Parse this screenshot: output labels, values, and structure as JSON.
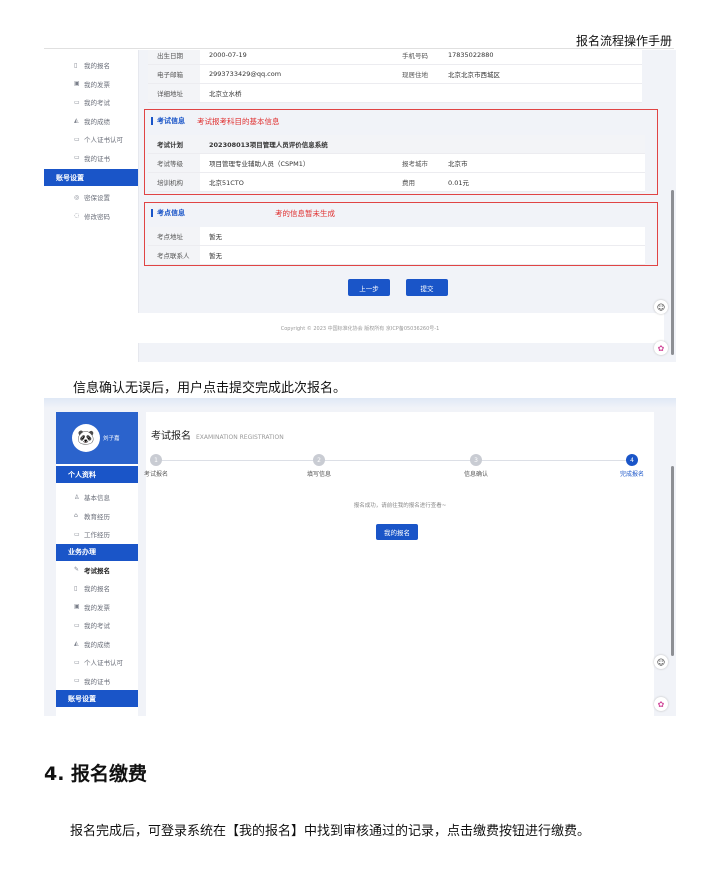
{
  "header": {
    "title": "报名流程操作手册"
  },
  "shot1": {
    "sidebar": {
      "items_top": [
        {
          "icon": "file-icon",
          "glyph": "▯",
          "label": "我的报名"
        },
        {
          "icon": "invoice-icon",
          "glyph": "▣",
          "label": "我的发票"
        },
        {
          "icon": "exam-icon",
          "glyph": "▭",
          "label": "我的考试"
        },
        {
          "icon": "score-icon",
          "glyph": "◭",
          "label": "我的成绩"
        },
        {
          "icon": "cert-icon",
          "glyph": "▭",
          "label": "个人证书认可"
        },
        {
          "icon": "certificate-icon",
          "glyph": "▭",
          "label": "我的证书"
        }
      ],
      "account_head": "账号设置",
      "items_account": [
        {
          "icon": "shield-icon",
          "glyph": "◎",
          "label": "密保设置"
        },
        {
          "icon": "lock-icon",
          "glyph": "◌",
          "label": "修改密码"
        }
      ]
    },
    "personal_rows": [
      {
        "l1": "出生日期",
        "v1": "2000-07-19",
        "l2": "手机号码",
        "v2": "17835022880"
      },
      {
        "l1": "电子邮箱",
        "v1": "2993733429@qq.com",
        "l2": "现居住地",
        "v2": "北京北京市西城区"
      },
      {
        "l1": "详细地址",
        "v1": "北京立水桥",
        "l2": "",
        "v2": ""
      }
    ],
    "exam_section": {
      "title": "考试信息",
      "note": "考试报考科目的基本信息",
      "plan_label": "考试计划",
      "plan_value": "202308013项目管理人员评价信息系统",
      "rows": [
        {
          "l1": "考试等级",
          "v1": "项目管理专业辅助人员（CSPM1）",
          "l2": "报考城市",
          "v2": "北京市"
        },
        {
          "l1": "培训机构",
          "v1": "北京51CTO",
          "l2": "费用",
          "v2": "0.01元"
        }
      ]
    },
    "site_section": {
      "title": "考点信息",
      "note": "考的信息暂未生成",
      "rows": [
        {
          "l": "考点地址",
          "v": "暂无"
        },
        {
          "l": "考点联系人",
          "v": "暂无"
        }
      ]
    },
    "buttons": {
      "prev": "上一步",
      "submit": "提交"
    },
    "footer": "Copyright © 2023 中国标准化协会 版权所有 京ICP备05036260号-1"
  },
  "caption": "信息确认无误后，用户点击提交完成此次报名。",
  "shot2": {
    "user_name": "刘子嘉",
    "sidebar": {
      "profile_head": "个人资料",
      "profile_items": [
        {
          "icon": "user-icon",
          "glyph": "♙",
          "label": "基本信息"
        },
        {
          "icon": "education-icon",
          "glyph": "⌂",
          "label": "教育经历"
        },
        {
          "icon": "briefcase-icon",
          "glyph": "▭",
          "label": "工作经历"
        }
      ],
      "business_head": "业务办理",
      "business_items": [
        {
          "icon": "pen-icon",
          "glyph": "✎",
          "label": "考试报名"
        },
        {
          "icon": "file-icon",
          "glyph": "▯",
          "label": "我的报名"
        },
        {
          "icon": "invoice-icon",
          "glyph": "▣",
          "label": "我的发票"
        },
        {
          "icon": "exam-icon",
          "glyph": "▭",
          "label": "我的考试"
        },
        {
          "icon": "score-icon",
          "glyph": "◭",
          "label": "我的成绩"
        },
        {
          "icon": "cert-icon",
          "glyph": "▭",
          "label": "个人证书认可"
        },
        {
          "icon": "certificate-icon",
          "glyph": "▭",
          "label": "我的证书"
        }
      ],
      "account_head": "账号设置"
    },
    "page_title": "考试报名",
    "page_subtitle": "EXAMINATION REGISTRATION",
    "steps": [
      {
        "num": "1",
        "label": "考试报名"
      },
      {
        "num": "2",
        "label": "填写信息"
      },
      {
        "num": "3",
        "label": "信息确认"
      },
      {
        "num": "4",
        "label": "完成报名"
      }
    ],
    "success_text": "报名成功，请前往我的报名进行查看~",
    "my_reg_button": "我的报名"
  },
  "section": {
    "heading": "4. 报名缴费",
    "paragraph": "报名完成后，可登录系统在【我的报名】中找到审核通过的记录，点击缴费按钮进行缴费。"
  }
}
